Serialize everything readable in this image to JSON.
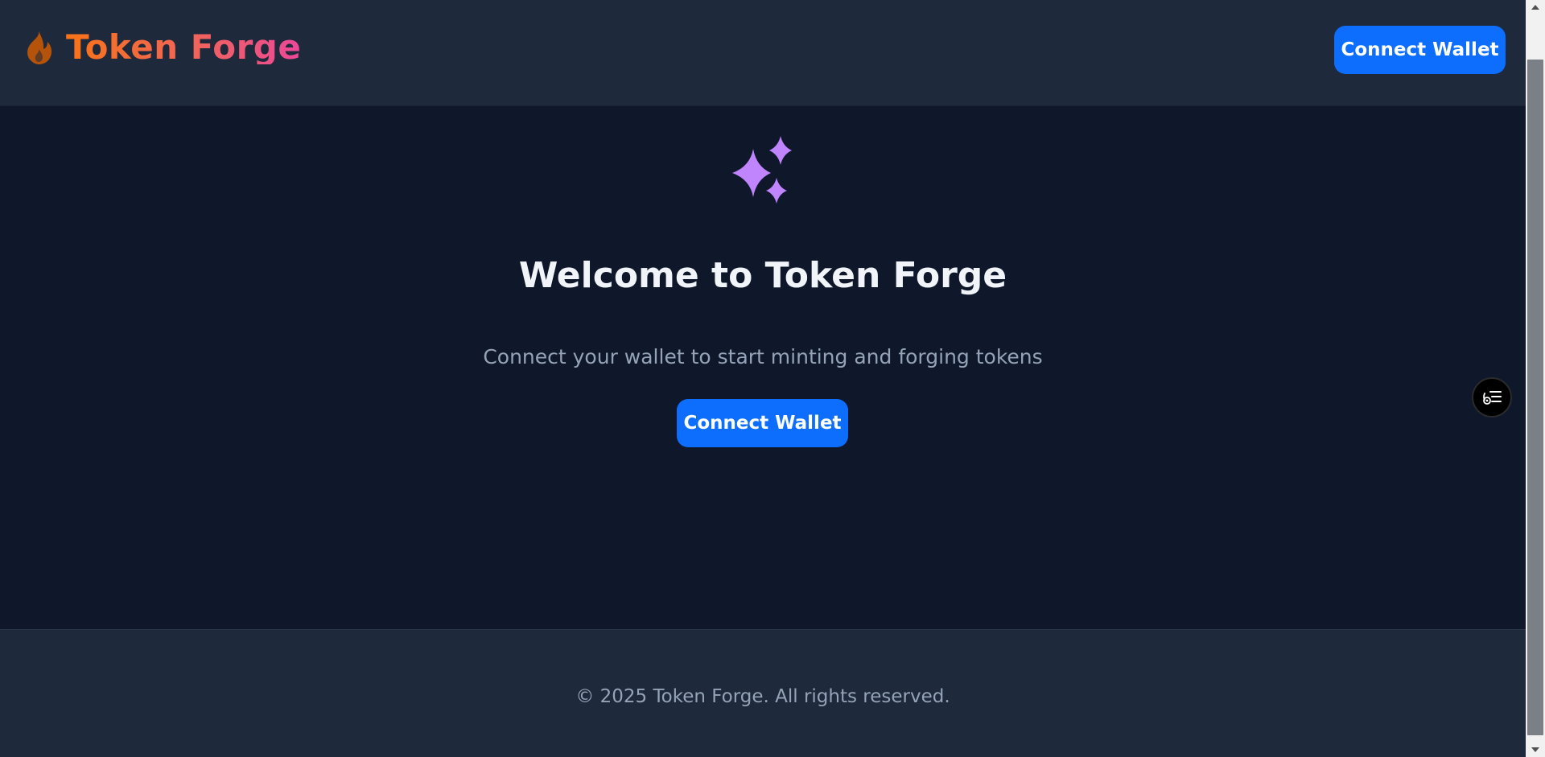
{
  "header": {
    "brand_icon": "flame-icon",
    "brand_title": "Token Forge",
    "connect_label": "Connect Wallet"
  },
  "hero": {
    "icon": "sparkles-icon",
    "title": "Welcome to Token Forge",
    "subtitle": "Connect your wallet to start minting and forging tokens",
    "connect_label": "Connect Wallet"
  },
  "footer": {
    "copyright": "© 2025 Token Forge. All rights reserved."
  },
  "floating_button": {
    "icon": "reader-list-icon"
  },
  "colors": {
    "page_bg": "#0f172a",
    "header_bg": "#1e293b",
    "button_primary": "#0d6efd",
    "brand_gradient_start": "#f97316",
    "brand_gradient_end": "#ec4899",
    "sparkle": "#c084fc",
    "subtitle_text": "#94a3b8"
  }
}
